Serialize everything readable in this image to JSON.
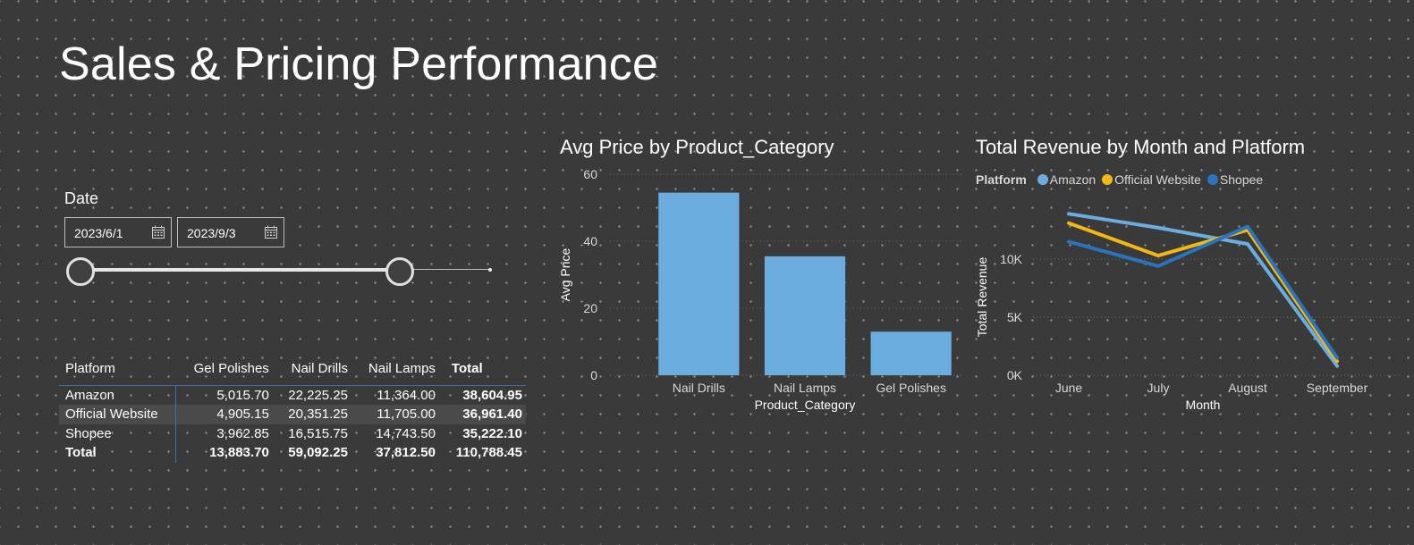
{
  "page": {
    "title": "Sales & Pricing Performance"
  },
  "slicer": {
    "label": "Date",
    "start": "2023/6/1",
    "end": "2023/9/3",
    "icon": "calendar-icon"
  },
  "matrix": {
    "columns": [
      "Platform",
      "Gel Polishes",
      "Nail Drills",
      "Nail Lamps",
      "Total"
    ],
    "rows": [
      {
        "platform": "Amazon",
        "values": [
          "5,015.70",
          "22,225.25",
          "11,364.00"
        ],
        "total": "38,604.95"
      },
      {
        "platform": "Official Website",
        "values": [
          "4,905.15",
          "20,351.25",
          "11,705.00"
        ],
        "total": "36,961.40"
      },
      {
        "platform": "Shopee",
        "values": [
          "3,962.85",
          "16,515.75",
          "14,743.50"
        ],
        "total": "35,222.10"
      }
    ],
    "total_row": {
      "label": "Total",
      "values": [
        "13,883.70",
        "59,092.25",
        "37,812.50"
      ],
      "total": "110,788.45"
    }
  },
  "bar_chart": {
    "title": "Avg Price by Product_Category",
    "chart_data": {
      "type": "bar",
      "categories": [
        "Nail Drills",
        "Nail Lamps",
        "Gel Polishes"
      ],
      "values": [
        54.5,
        35.5,
        13
      ],
      "xlabel": "Product_Category",
      "ylabel": "Avg Price",
      "ylim": [
        0,
        60
      ],
      "yticks": [
        "0",
        "20",
        "40",
        "60"
      ],
      "grid": true,
      "color": "#6cade0"
    }
  },
  "line_chart": {
    "title": "Total Revenue by Month and Platform",
    "legend": {
      "title": "Platform",
      "placement": "top-left"
    },
    "chart_data": {
      "type": "line",
      "categories": [
        "June",
        "July",
        "August",
        "September"
      ],
      "series": [
        {
          "name": "Amazon",
          "values": [
            13900,
            12700,
            11300,
            800
          ],
          "color": "#6cade0"
        },
        {
          "name": "Official Website",
          "values": [
            13100,
            10300,
            12500,
            1200
          ],
          "color": "#f2b814"
        },
        {
          "name": "Shopee",
          "values": [
            11500,
            9400,
            12800,
            1500
          ],
          "color": "#2a73bf"
        }
      ],
      "xlabel": "Month",
      "ylabel": "Total Revenue",
      "ylim": [
        0,
        15000
      ],
      "yticks": [
        "0K",
        "5K",
        "10K"
      ],
      "grid": true
    }
  }
}
